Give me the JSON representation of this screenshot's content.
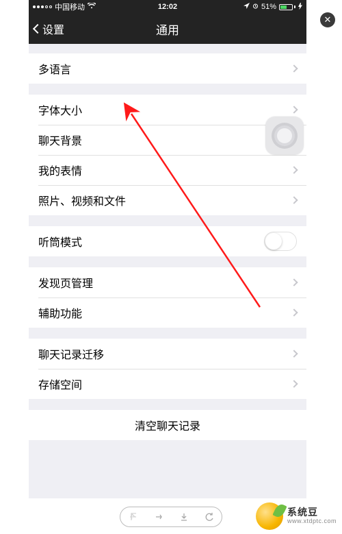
{
  "statusbar": {
    "carrier": "中国移动",
    "time": "12:02",
    "battery_pct": "51%"
  },
  "nav": {
    "back_label": "设置",
    "title": "通用"
  },
  "group1": [
    {
      "label": "多语言"
    }
  ],
  "group2": [
    {
      "label": "字体大小"
    },
    {
      "label": "聊天背景"
    },
    {
      "label": "我的表情"
    },
    {
      "label": "照片、视频和文件"
    }
  ],
  "group3": [
    {
      "label": "听筒模式",
      "toggle": false
    }
  ],
  "group4": [
    {
      "label": "发现页管理"
    },
    {
      "label": "辅助功能"
    }
  ],
  "group5": [
    {
      "label": "聊天记录迁移"
    },
    {
      "label": "存储空间"
    }
  ],
  "group6": [
    {
      "label": "清空聊天记录"
    }
  ],
  "watermark": {
    "line1": "系统豆",
    "line2": "www.xtdptc.com"
  },
  "overlay_close": "✕"
}
